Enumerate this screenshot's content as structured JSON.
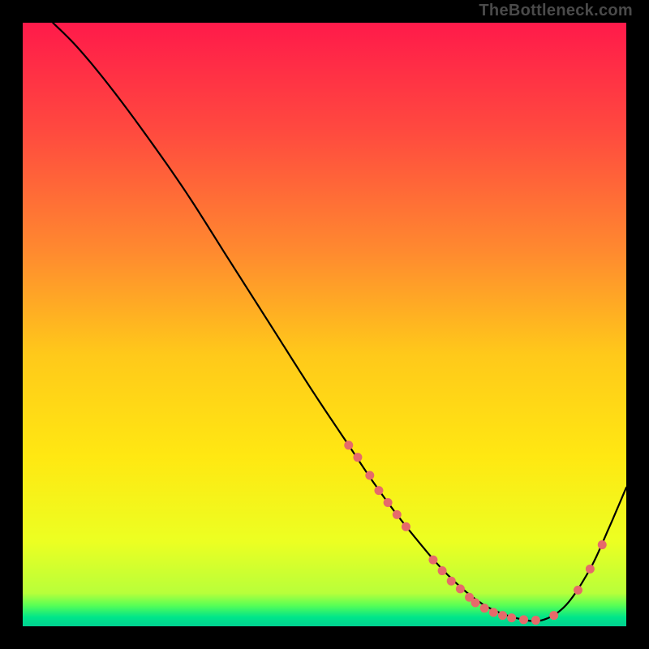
{
  "watermark": "TheBottleneck.com",
  "chart_data": {
    "type": "line",
    "title": "",
    "xlabel": "",
    "ylabel": "",
    "xlim": [
      0,
      100
    ],
    "ylim": [
      0,
      100
    ],
    "grid": false,
    "legend": false,
    "description": "Black curve descending from top-left to a minimum and rising again on the right, over a vertical gradient background from crimson (top) through orange/yellow to green (bottom). Salmon dots mark sampled points along the lower part of the curve.",
    "background_gradient_stops": [
      {
        "offset": 0.0,
        "color": "#ff1a4a"
      },
      {
        "offset": 0.18,
        "color": "#ff4a3f"
      },
      {
        "offset": 0.38,
        "color": "#ff8a2f"
      },
      {
        "offset": 0.55,
        "color": "#ffc91a"
      },
      {
        "offset": 0.72,
        "color": "#ffe812"
      },
      {
        "offset": 0.86,
        "color": "#ecff22"
      },
      {
        "offset": 0.945,
        "color": "#b8ff3a"
      },
      {
        "offset": 0.965,
        "color": "#5aff55"
      },
      {
        "offset": 0.985,
        "color": "#00e58a"
      },
      {
        "offset": 1.0,
        "color": "#00d090"
      }
    ],
    "curve": {
      "x": [
        5,
        9,
        14,
        20,
        27,
        34,
        41,
        48,
        54,
        58,
        62,
        66,
        69,
        72,
        75,
        78,
        82,
        86,
        90,
        94,
        97,
        100
      ],
      "y": [
        100,
        96,
        90,
        82,
        72,
        61,
        50,
        39,
        30,
        24,
        18.5,
        13.5,
        10,
        7,
        4.5,
        2.7,
        1.3,
        1.0,
        3.5,
        9.5,
        16,
        23
      ]
    },
    "dots": {
      "color": "#e66a6a",
      "points": [
        {
          "x": 54.0,
          "y": 30.0,
          "r": 5.5
        },
        {
          "x": 55.5,
          "y": 28.0,
          "r": 5.5
        },
        {
          "x": 57.5,
          "y": 25.0,
          "r": 5.5
        },
        {
          "x": 59.0,
          "y": 22.5,
          "r": 5.5
        },
        {
          "x": 60.5,
          "y": 20.5,
          "r": 5.5
        },
        {
          "x": 62.0,
          "y": 18.5,
          "r": 5.5
        },
        {
          "x": 63.5,
          "y": 16.5,
          "r": 5.5
        },
        {
          "x": 68.0,
          "y": 11.0,
          "r": 5.5
        },
        {
          "x": 69.5,
          "y": 9.2,
          "r": 5.5
        },
        {
          "x": 71.0,
          "y": 7.5,
          "r": 5.5
        },
        {
          "x": 72.5,
          "y": 6.2,
          "r": 5.5
        },
        {
          "x": 74.0,
          "y": 4.8,
          "r": 5.5
        },
        {
          "x": 75.0,
          "y": 3.9,
          "r": 5.5
        },
        {
          "x": 76.5,
          "y": 3.0,
          "r": 5.5
        },
        {
          "x": 78.0,
          "y": 2.3,
          "r": 5.5
        },
        {
          "x": 79.5,
          "y": 1.8,
          "r": 5.5
        },
        {
          "x": 81.0,
          "y": 1.4,
          "r": 5.5
        },
        {
          "x": 83.0,
          "y": 1.1,
          "r": 5.5
        },
        {
          "x": 85.0,
          "y": 1.0,
          "r": 5.5
        },
        {
          "x": 88.0,
          "y": 1.8,
          "r": 5.5
        },
        {
          "x": 92.0,
          "y": 6.0,
          "r": 5.5
        },
        {
          "x": 94.0,
          "y": 9.5,
          "r": 5.5
        },
        {
          "x": 96.0,
          "y": 13.5,
          "r": 5.5
        }
      ]
    }
  }
}
